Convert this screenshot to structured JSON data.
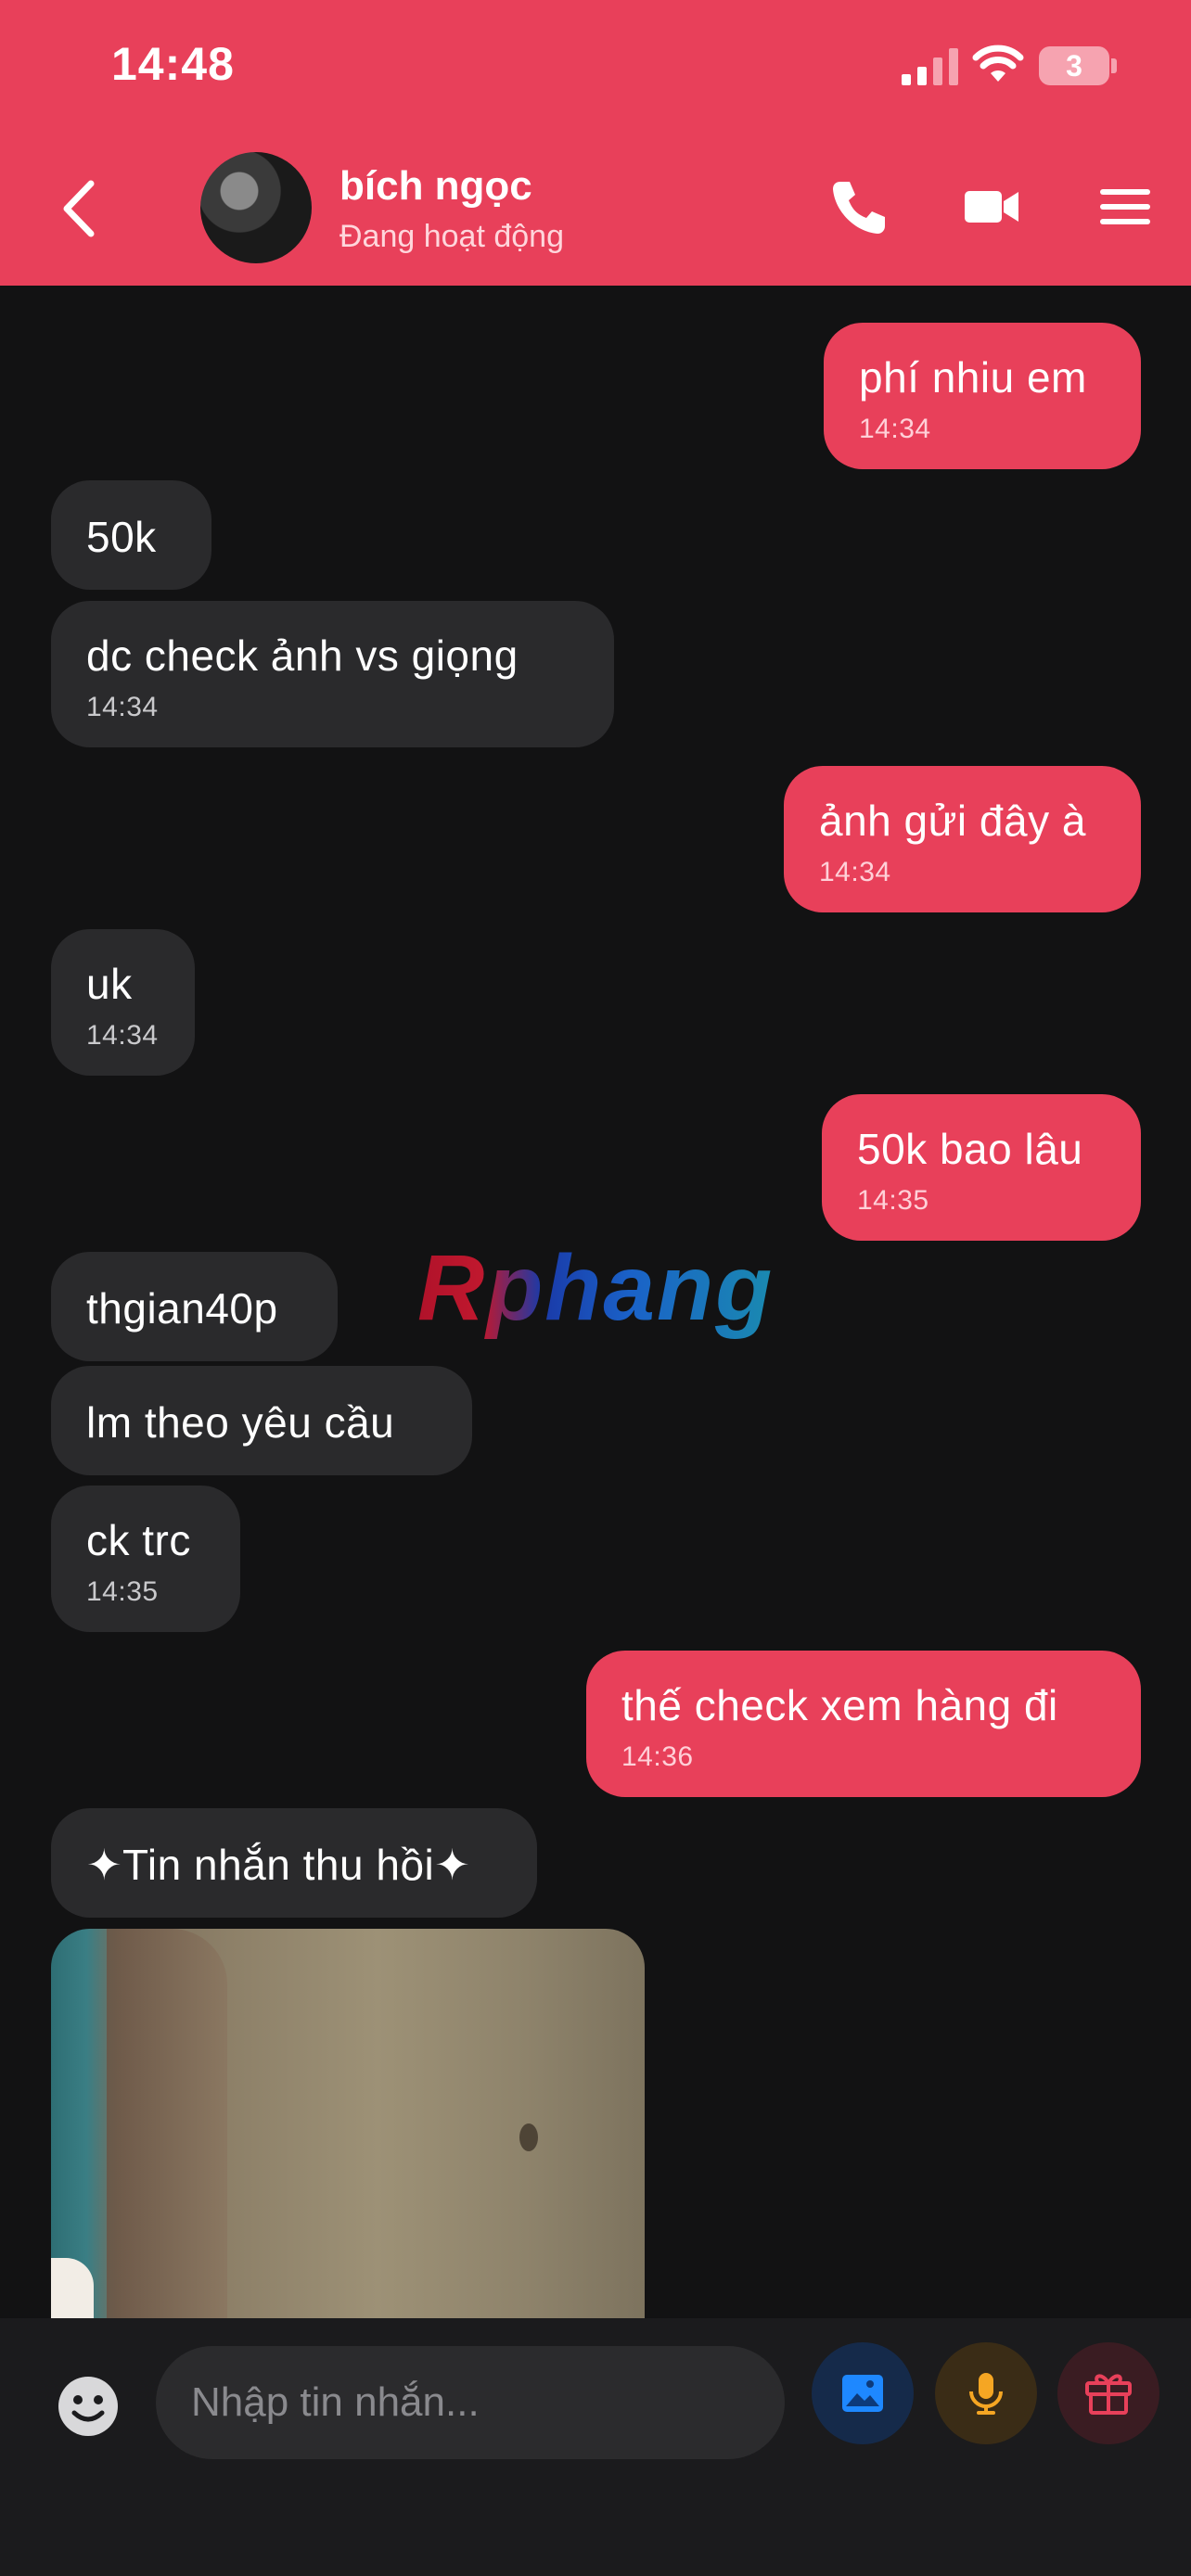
{
  "status_bar": {
    "time": "14:48",
    "battery": "3"
  },
  "header": {
    "name": "bích ngọc",
    "status": "Đang hoạt động"
  },
  "messages": [
    {
      "text": "phí nhiu em",
      "time": "14:34"
    },
    {
      "text": "50k"
    },
    {
      "text": "dc check ảnh vs giọng",
      "time": "14:34"
    },
    {
      "text": "ảnh gửi đây à",
      "time": "14:34"
    },
    {
      "text": "uk",
      "time": "14:34"
    },
    {
      "text": "50k bao lâu",
      "time": "14:35"
    },
    {
      "text": "thgian40p"
    },
    {
      "text": "lm theo yêu cầu"
    },
    {
      "text": "ck trc",
      "time": "14:35"
    },
    {
      "text": "thế check xem hàng đi",
      "time": "14:36"
    },
    {
      "text": "✦Tin nhắn thu hồi✦"
    }
  ],
  "watermark": "Rphang",
  "composer": {
    "placeholder": "Nhập tin nhắn..."
  },
  "colors": {
    "accent": "#e8405a",
    "background": "#121213",
    "incoming_bubble": "#2a2a2c"
  },
  "icons": [
    "back-icon",
    "phone-icon",
    "video-icon",
    "menu-icon",
    "emoji-icon",
    "image-icon",
    "mic-icon",
    "gift-icon"
  ]
}
